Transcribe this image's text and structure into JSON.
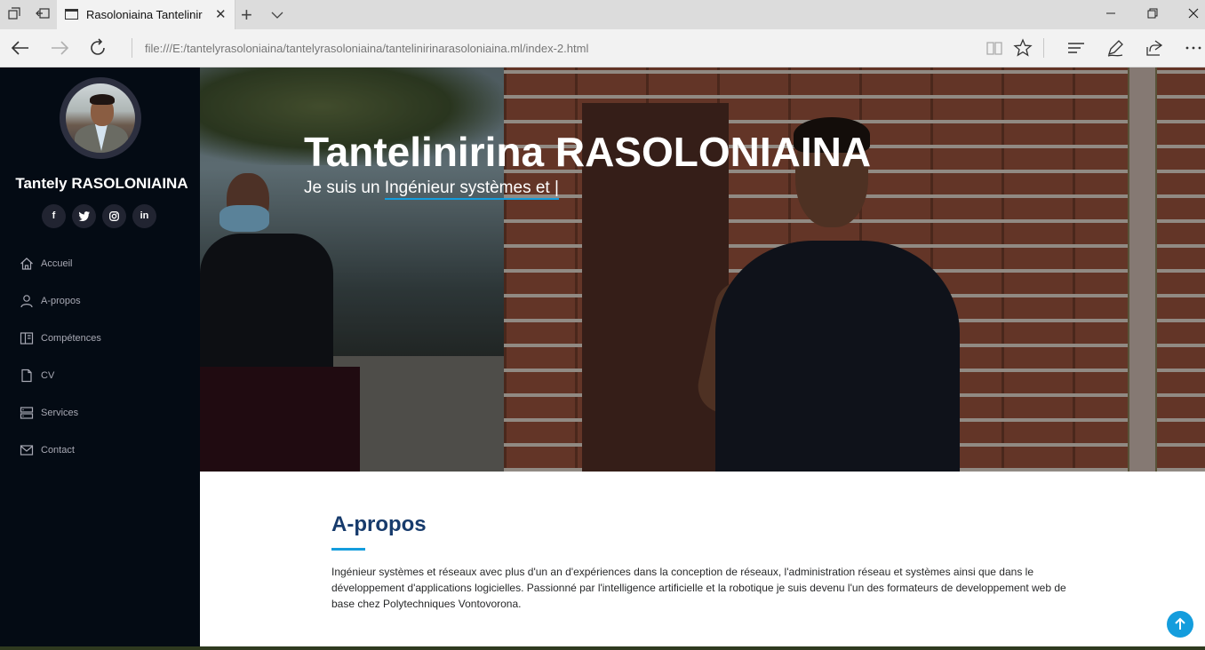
{
  "browser": {
    "tab_title": "Rasoloniaina Tantelinir",
    "url": "file:///E:/tantelyrasoloniaina/tantelyrasoloniaina/tantelinirinarasoloniaina.ml/index-2.html"
  },
  "sidebar": {
    "name": "Tantely RASOLONIAINA",
    "socials": [
      {
        "icon": "facebook-icon",
        "glyph": "f"
      },
      {
        "icon": "twitter-icon",
        "glyph": "t"
      },
      {
        "icon": "instagram-icon",
        "glyph": "◎"
      },
      {
        "icon": "linkedin-icon",
        "glyph": "in"
      }
    ],
    "items": [
      {
        "label": "Accueil",
        "icon": "home-icon"
      },
      {
        "label": "A-propos",
        "icon": "user-icon"
      },
      {
        "label": "Compétences",
        "icon": "file-columns-icon"
      },
      {
        "label": "CV",
        "icon": "document-icon"
      },
      {
        "label": "Services",
        "icon": "server-icon"
      },
      {
        "label": "Contact",
        "icon": "envelope-icon"
      }
    ]
  },
  "hero": {
    "title": "Tantelinirina RASOLONIAINA",
    "subtitle_prefix": "Je suis un ",
    "subtitle_typed": "Ingénieur systèmes et |"
  },
  "about": {
    "title": "A-propos",
    "text": "Ingénieur systèmes et réseaux avec plus d'un an d'expériences dans la conception de réseaux, l'administration réseau et systèmes ainsi que dans le développement d'applications logicielles. Passionné par l'intelligence artificielle et la robotique je suis devenu l'un des formateurs de developpement web de base chez Polytechniques Vontovorona."
  },
  "colors": {
    "accent": "#149ddd",
    "sidebar_bg": "#040b14",
    "heading": "#173b6c"
  }
}
